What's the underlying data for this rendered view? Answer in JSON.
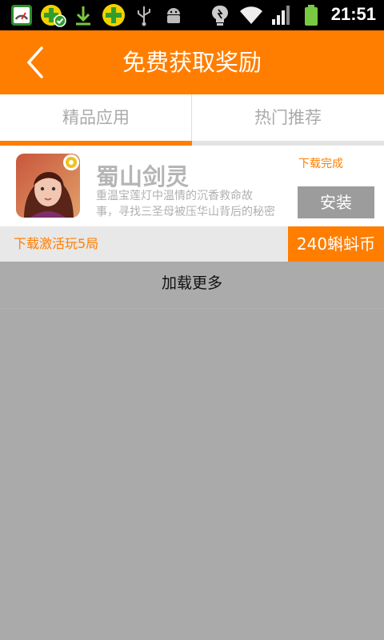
{
  "status_bar": {
    "time": "21:51",
    "icons": [
      "speed-monitor-icon",
      "360-security-check-icon",
      "download-icon",
      "360-plus-icon",
      "usb-icon",
      "android-debug-icon",
      "bulb-icon",
      "wifi-icon",
      "signal-icon",
      "battery-icon"
    ]
  },
  "header": {
    "title": "免费获取奖励",
    "back_icon": "chevron-left-icon"
  },
  "tabs": [
    {
      "label": "精品应用",
      "selected": true
    },
    {
      "label": "热门推荐",
      "selected": false
    }
  ],
  "app": {
    "name": "蜀山剑灵",
    "description_line1": "重温宝莲灯中温情的沉香救命故",
    "description_line2": "事，寻找三圣母被压华山背后的秘密",
    "download_status": "下载完成",
    "install_label": "安装",
    "icon": "app-avatar-icon"
  },
  "reward": {
    "task": "下载激活玩5局",
    "amount": "240蝌蚪币"
  },
  "load_more": "加载更多",
  "colors": {
    "accent": "#ff7e00",
    "background": "#aaaaaa",
    "install_button": "#9c9c9c"
  }
}
